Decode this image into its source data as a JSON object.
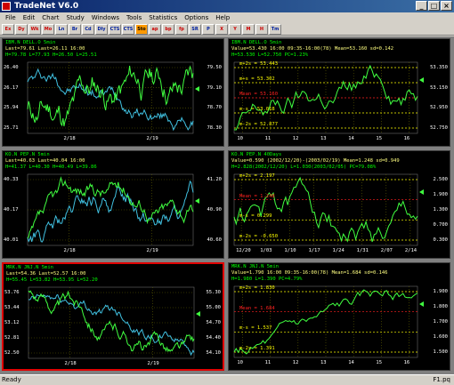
{
  "window": {
    "title": "TradeNet V6.0",
    "min": "_",
    "max": "□",
    "close": "×"
  },
  "menu": [
    "File",
    "Edit",
    "Chart",
    "Study",
    "Windows",
    "Tools",
    "Statistics",
    "Options",
    "Help"
  ],
  "toolbar": [
    "Ex",
    "Dy",
    "Wk",
    "Mo",
    "Ln",
    "Br",
    "Cd",
    "Dly",
    "CTS",
    "CTS",
    "Sto",
    "ap",
    "bp",
    "fp",
    "SR",
    "P",
    "X",
    "Y",
    "M",
    "H",
    "Tm"
  ],
  "status": {
    "left": "Ready",
    "right": "F1.pq"
  },
  "panels": [
    {
      "id": "p1",
      "header": [
        "IBM.N DELL.O 5min",
        "Last=79.61  Last=26.11 16:00",
        "H=79.78 L=77.93  H=26.50 L=25.51"
      ],
      "header_colors": [
        "#00ff00",
        "#00ff00",
        "#00ff00"
      ],
      "left_ticks": [
        "26.40",
        "26.17",
        "25.94",
        "25.71"
      ],
      "right_ticks": [
        "79.50",
        "79.10",
        "78.70",
        "78.30"
      ],
      "x_ticks": [
        "2/18",
        "2/19"
      ],
      "marker": ""
    },
    {
      "id": "p2",
      "header": [
        "IBM.N DELL.O 5min",
        "Value=53.430 16:00  09:35-16:00(78)  Mean=53.160  sd=0.142",
        "H=53.530 L=52.750  PC=1.23%"
      ],
      "header_colors": [
        "#00ff00",
        "#00ff00",
        "#00ff00"
      ],
      "left_ticks": [
        "m+2s = 53.443",
        "m+s = 53.302",
        "Mean = 53.160",
        "m-s = 53.018",
        "m-2s = 52.877"
      ],
      "right_ticks": [
        "53.350",
        "53.150",
        "52.950",
        "52.750"
      ],
      "x_ticks": [
        "10",
        "11",
        "12",
        "13",
        "14",
        "15",
        "16"
      ],
      "marker": ""
    },
    {
      "id": "p3",
      "header": [
        "KO.N PEP.N 5min",
        "Last=40.63  Last=40.04 16:00",
        "H=41.37 L=40.30  H=40.49 L=39.86"
      ],
      "header_colors": [
        "#00ff00",
        "#00ff00",
        "#00ff00"
      ],
      "left_ticks": [
        "40.33",
        "40.17",
        "40.01"
      ],
      "right_ticks": [
        "41.20",
        "40.90",
        "40.60"
      ],
      "x_ticks": [
        "2/18",
        "2/19"
      ],
      "marker": ""
    },
    {
      "id": "p4",
      "header": [
        "KO.N PEP.N 40Days",
        "Value=0.590 (2002/12/20)-(2003/02/19)  Mean=1.248  sd=0.949",
        "H=2.828(2002/12/20) L=1.030(2003/02/05)  PC=79.08%"
      ],
      "header_colors": [
        "#00ff00",
        "#00ff00",
        "#00ff00"
      ],
      "left_ticks": [
        "m+2s = 2.197",
        "Mean = 1.248",
        "m-s = 0.299",
        "m-2s = -0.650"
      ],
      "right_ticks": [
        "2.500",
        "1.900",
        "1.300",
        "0.700",
        "0.300"
      ],
      "x_ticks": [
        "12/20",
        "1/03",
        "1/10",
        "1/17",
        "1/24",
        "1/31",
        "2/07",
        "2/14"
      ],
      "marker": ""
    },
    {
      "id": "p5",
      "header": [
        "MRK.N JNJ.N 5min",
        "Last=54.36  Last=52.57 16:00",
        "H=55.45 L=53.82  H=53.95 L=52.20"
      ],
      "header_colors": [
        "#00ff00",
        "#00ff00",
        "#00ff00"
      ],
      "left_ticks": [
        "53.76",
        "53.44",
        "53.12",
        "52.81",
        "52.50"
      ],
      "right_ticks": [
        "55.30",
        "55.00",
        "54.70",
        "54.40",
        "54.10"
      ],
      "x_ticks": [
        "2/18",
        "2/19"
      ],
      "marker": ""
    },
    {
      "id": "p6",
      "header": [
        "MRK.N JNJ.N 5min",
        "Value=1.790 16:00  09:35-16:00(78)  Mean=1.684  sd=0.146",
        "H=1.980 L=1.390  PC=4.79%"
      ],
      "header_colors": [
        "#00ff00",
        "#00ff00",
        "#00ff00"
      ],
      "left_ticks": [
        "m+2s = 1.830",
        "Mean = 1.684",
        "m-s = 1.537",
        "m-2s = 1.391"
      ],
      "right_ticks": [
        "1.900",
        "1.800",
        "1.700",
        "1.600",
        "1.500"
      ],
      "x_ticks": [
        "10",
        "11",
        "12",
        "13",
        "14",
        "15",
        "16"
      ],
      "marker": ""
    }
  ],
  "colors": {
    "chart_bg": "#000000",
    "line_green": "#40ff40",
    "line_cyan": "#40c0e0",
    "grid": "#606000",
    "mean_red": "#ff2020",
    "band_yellow": "#ffff00"
  }
}
